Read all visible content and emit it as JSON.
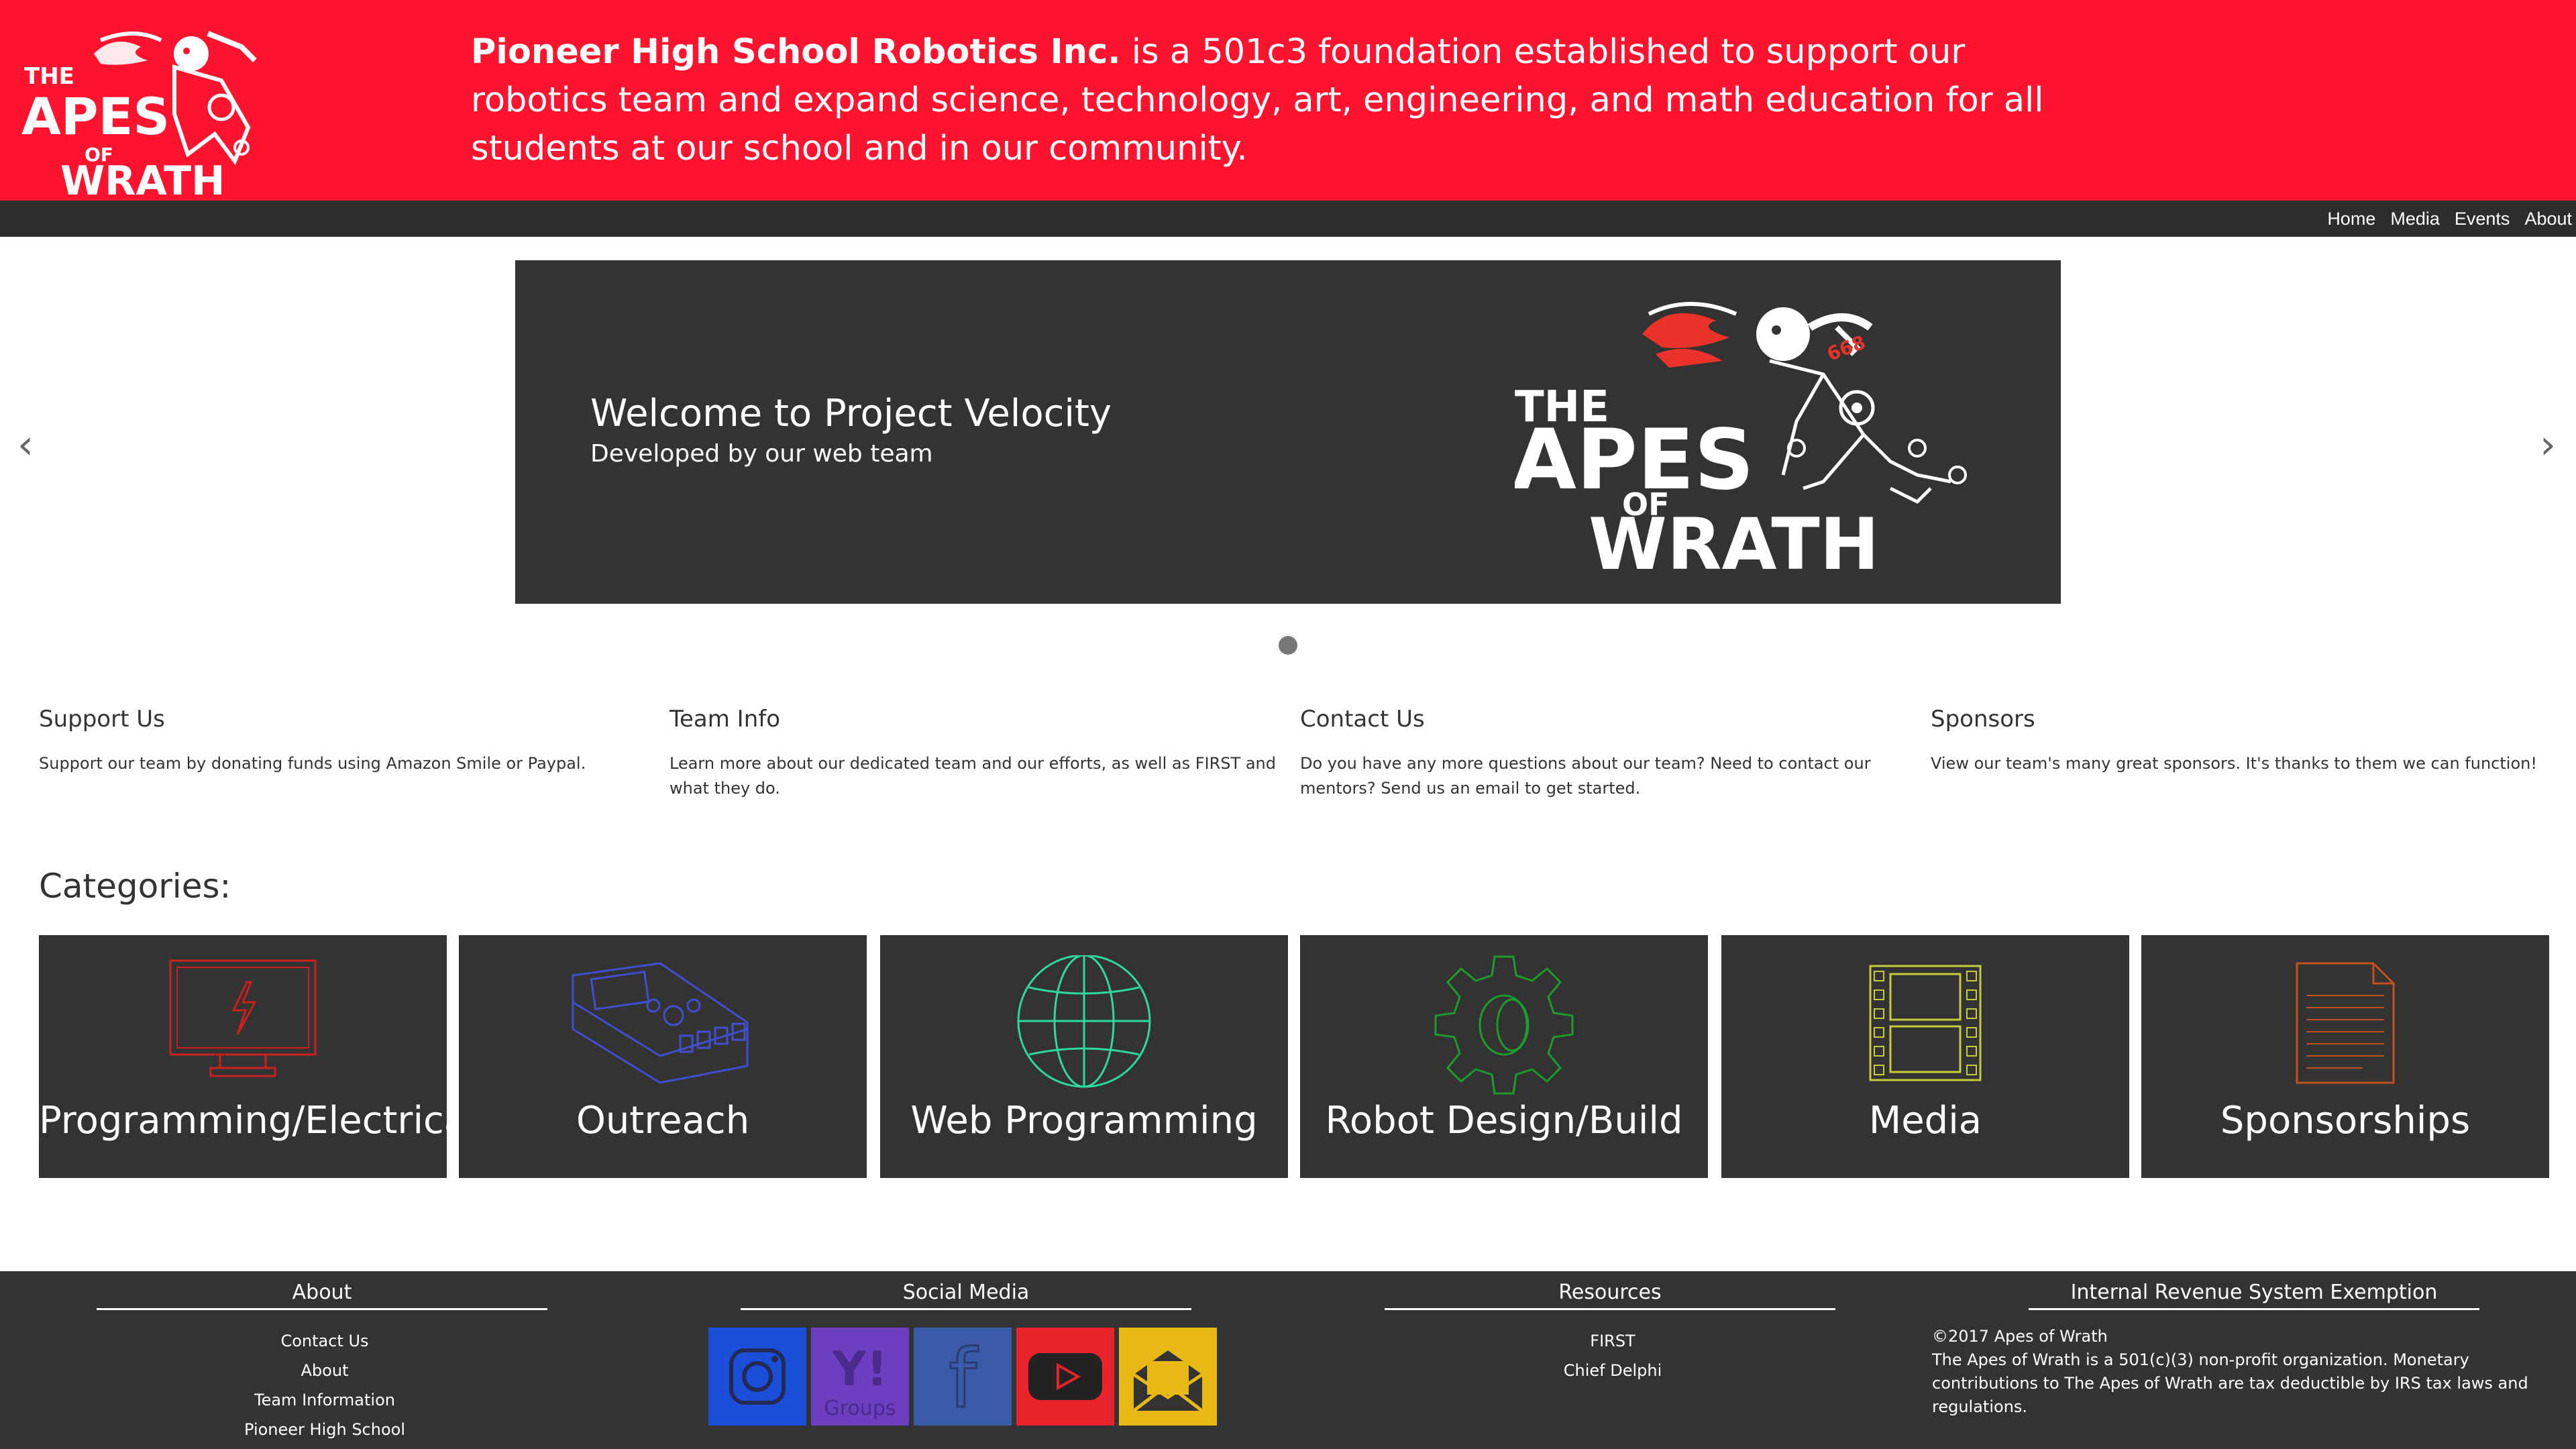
{
  "header": {
    "logo_text": [
      "THE",
      "APES",
      "OF",
      "WRATH"
    ],
    "org_name": "Pioneer High School Robotics Inc.",
    "mission": " is a 501c3 foundation established to support our robotics team and expand science, technology, art, engineering, and math education for all students at our school and in our community."
  },
  "nav": {
    "items": [
      "Home",
      "Media",
      "Events",
      "About"
    ]
  },
  "carousel": {
    "prev": "‹",
    "next": "›",
    "title": "Welcome to Project Velocity",
    "subtitle": "Developed by our web team",
    "logo_text": [
      "THE",
      "APES",
      "OF",
      "WRATH"
    ],
    "team_number": "668"
  },
  "info": [
    {
      "title": "Support Us",
      "desc": "Support our team by donating funds using Amazon Smile or Paypal."
    },
    {
      "title": "Team Info",
      "desc": "Learn more about our dedicated team and our efforts, as well as FIRST and what they do."
    },
    {
      "title": "Contact Us",
      "desc": "Do you have any more questions about our team? Need to contact our mentors? Send us an email to get started."
    },
    {
      "title": "Sponsors",
      "desc": "View our team's many great sponsors. It's thanks to them we can function!"
    }
  ],
  "categories": {
    "heading": "Categories:",
    "items": [
      {
        "label": "Programming/Electrical",
        "icon": "monitor-lightning-icon",
        "color": "#cc1f1f"
      },
      {
        "label": "Outreach",
        "icon": "robot-controller-icon",
        "color": "#3f4fd0"
      },
      {
        "label": "Web Programming",
        "icon": "globe-icon",
        "color": "#2fd89c"
      },
      {
        "label": "Robot Design/Build",
        "icon": "gear-icon",
        "color": "#1c9c2c"
      },
      {
        "label": "Media",
        "icon": "film-strip-icon",
        "color": "#c6cc3a"
      },
      {
        "label": "Sponsorships",
        "icon": "document-icon",
        "color": "#c0501c"
      }
    ]
  },
  "footer": {
    "about": {
      "heading": "About",
      "links": [
        "Contact Us",
        "About",
        "Team Information",
        "Pioneer High School"
      ]
    },
    "social": {
      "heading": "Social Media",
      "buttons": [
        {
          "name": "instagram",
          "icon": "instagram-icon",
          "color": "#1c4fd9"
        },
        {
          "name": "yahoo-groups",
          "icon": "yahoo-groups-icon",
          "color": "#6b3fc0",
          "text": "Y!",
          "subtext": "Groups"
        },
        {
          "name": "facebook",
          "icon": "facebook-icon",
          "color": "#3b5aa8",
          "text": "f"
        },
        {
          "name": "youtube",
          "icon": "youtube-icon",
          "color": "#e8232b"
        },
        {
          "name": "email",
          "icon": "mail-icon",
          "color": "#e8b914"
        }
      ]
    },
    "resources": {
      "heading": "Resources",
      "links": [
        "FIRST",
        "Chief Delphi"
      ]
    },
    "irs": {
      "heading": "Internal Revenue System Exemption",
      "lines": [
        "©2017 Apes of Wrath",
        "The Apes of Wrath is a 501(c)(3) non-profit organization. Monetary contributions to The Apes of Wrath are tax deductible by IRS tax laws and regulations."
      ]
    }
  }
}
